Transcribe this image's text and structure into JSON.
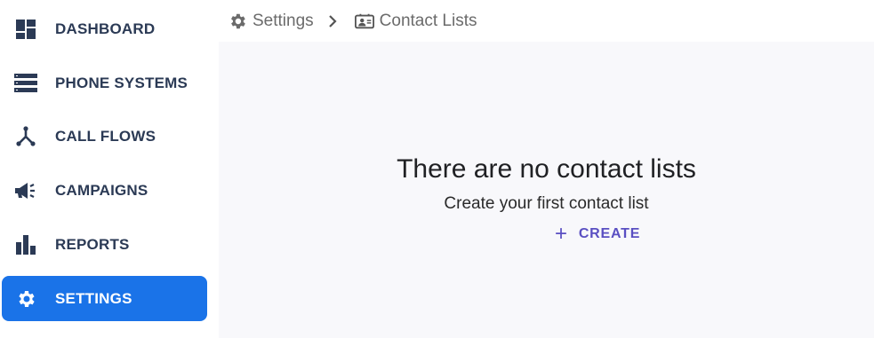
{
  "sidebar": {
    "items": [
      {
        "label": "DASHBOARD",
        "icon": "dashboard-icon"
      },
      {
        "label": "PHONE SYSTEMS",
        "icon": "server-icon"
      },
      {
        "label": "CALL FLOWS",
        "icon": "call-flow-icon"
      },
      {
        "label": "CAMPAIGNS",
        "icon": "megaphone-icon"
      },
      {
        "label": "REPORTS",
        "icon": "bar-chart-icon"
      },
      {
        "label": "SETTINGS",
        "icon": "gear-icon",
        "active": true
      }
    ]
  },
  "breadcrumb": {
    "items": [
      {
        "label": "Settings",
        "icon": "gear-icon"
      },
      {
        "label": "Contact Lists",
        "icon": "contact-card-icon"
      }
    ]
  },
  "empty_state": {
    "title": "There are no contact lists",
    "subtitle": "Create your first contact list",
    "create_label": "CREATE"
  },
  "colors": {
    "accent": "#1a73e8",
    "nav_text": "#2b3a55",
    "create_text": "#5a4fc2",
    "background": "#f8f8fb"
  }
}
